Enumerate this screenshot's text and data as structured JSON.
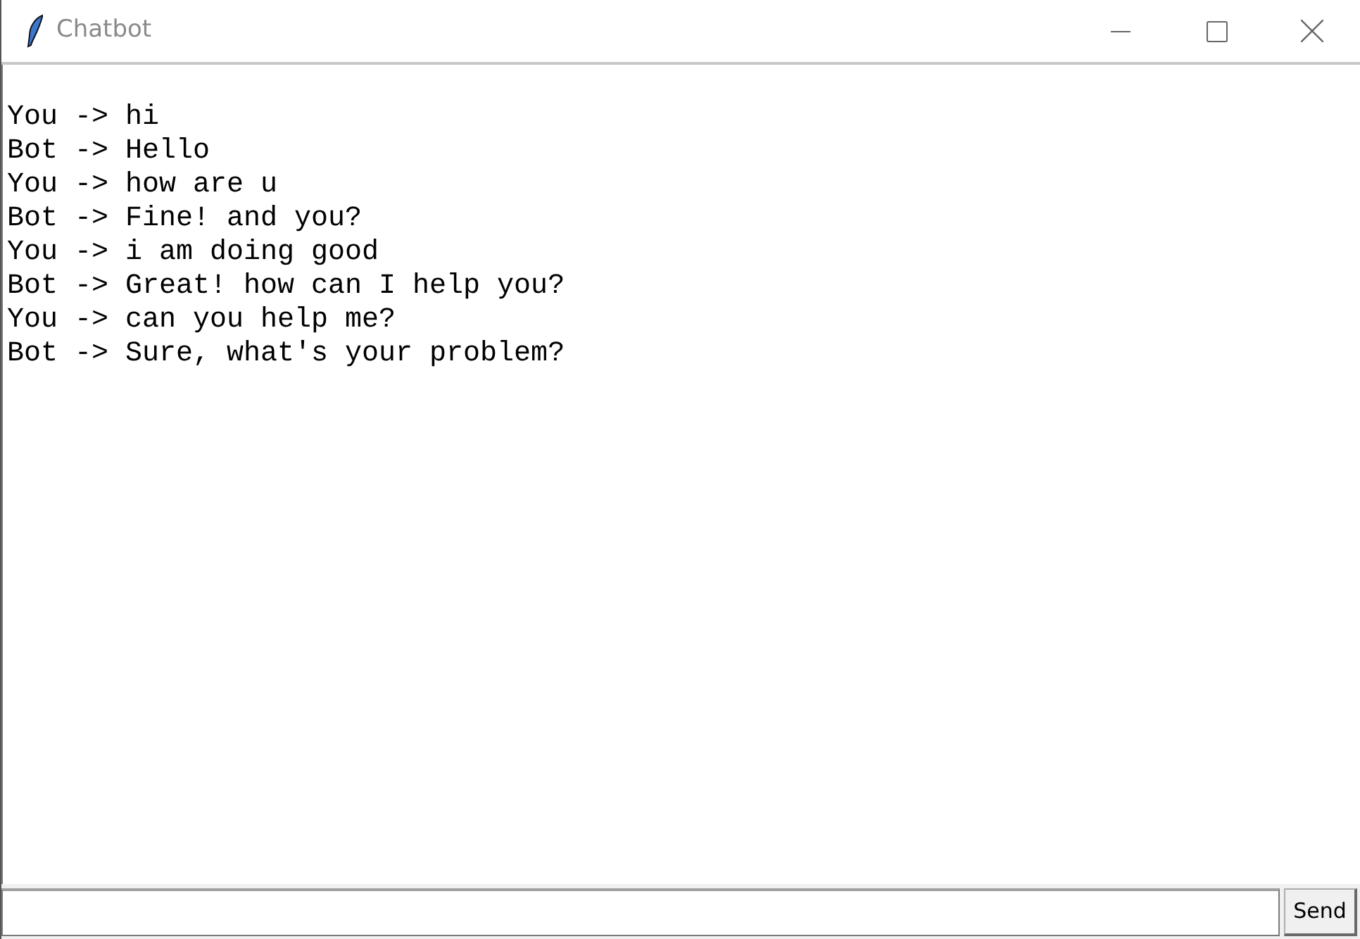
{
  "window": {
    "title": "Chatbot"
  },
  "chat_log": [
    "You -> hi",
    "Bot -> Hello",
    "You -> how are u",
    "Bot -> Fine! and you?",
    "You -> i am doing good",
    "Bot -> Great! how can I help you?",
    "You -> can you help me?",
    "Bot -> Sure, what's your problem?"
  ],
  "send_button": "Send"
}
